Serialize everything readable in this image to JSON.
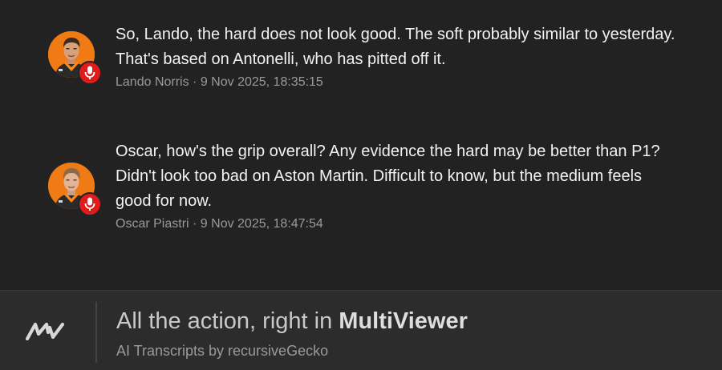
{
  "messages": [
    {
      "text": "So, Lando, the hard does not look good. The soft probably similar to yesterday. That's based on Antonelli, who has pitted off it.",
      "meta": "Lando Norris · 9 Nov 2025, 18:35:15",
      "avatar_icon": "driver-avatar-icon",
      "badge_icon": "microphone-icon"
    },
    {
      "text": "Oscar, how's the grip overall? Any evidence the hard may be better than P1? Didn't look too bad on Aston Martin. Difficult to know, but the medium feels good for now.",
      "meta": "Oscar Piastri · 9 Nov 2025, 18:47:54",
      "avatar_icon": "driver-avatar-icon",
      "badge_icon": "microphone-icon"
    }
  ],
  "footer": {
    "headline_prefix": "All the action, right in ",
    "headline_brand": "MultiViewer",
    "subtitle": "AI Transcripts by recursiveGecko",
    "logo_icon": "multiviewer-logo-icon"
  },
  "colors": {
    "background": "#222222",
    "footer_background": "#2c2c2c",
    "avatar_orange": "#f07a14",
    "mic_badge_red": "#e01b1b",
    "text_primary": "#f2f2f2",
    "text_meta": "#9a9a9a"
  }
}
